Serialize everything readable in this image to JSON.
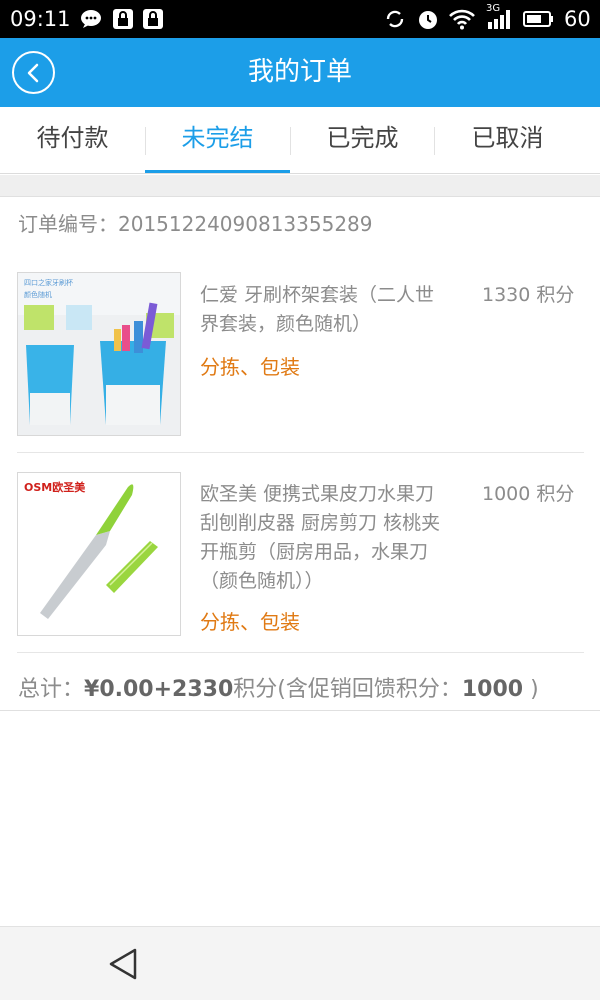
{
  "status_bar": {
    "time": "09:11",
    "app_icons": [
      "chat-bubble-icon",
      "lock-app-icon",
      "lock-app-icon"
    ],
    "right_icons": [
      "sync-icon",
      "alarm-icon",
      "wifi-icon",
      "signal-icon",
      "battery-icon"
    ],
    "network_label": "3G",
    "battery": "60"
  },
  "header": {
    "title": "我的订单",
    "back_icon": "chevron-left-icon",
    "color": "#1c9ee8"
  },
  "tabs": [
    {
      "label": "待付款",
      "active": false
    },
    {
      "label": "未完结",
      "active": true
    },
    {
      "label": "已完成",
      "active": false
    },
    {
      "label": "已取消",
      "active": false
    }
  ],
  "order": {
    "number_label": "订单编号：",
    "number": "20151224090813355289",
    "items": [
      {
        "name_lines": [
          "仁爱 牙刷杯架套装（二人世",
          "界套装，颜色随机）"
        ],
        "points": "1330 积分",
        "status": "分拣、包装",
        "image_icon": "toothbrush-cup-product-image"
      },
      {
        "name_lines": [
          "欧圣美 便携式果皮刀水果刀",
          "刮刨削皮器 厨房剪刀 核桃夹",
          "开瓶剪（厨房用品，水果刀",
          "（颜色随机））"
        ],
        "points": "1000 积分",
        "status": "分拣、包装",
        "brand": "OSM欧圣美",
        "image_icon": "fruit-knife-product-image"
      }
    ],
    "total": {
      "label": "总计：",
      "amount": "¥0.00+2330",
      "points_unit": "积分(含促销回馈积分：",
      "promo_points": "1000",
      "close": " )"
    }
  },
  "nav_bar": {
    "back_icon": "triangle-back-icon"
  },
  "colors": {
    "accent": "#1c9ee8",
    "status_orange": "#e07a14"
  }
}
